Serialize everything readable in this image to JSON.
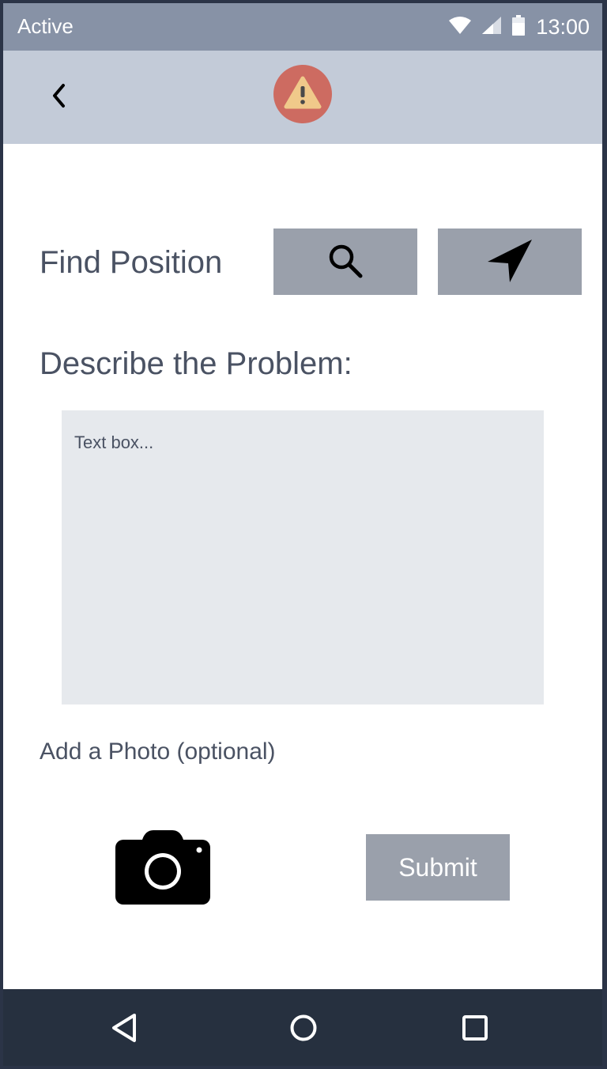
{
  "status_bar": {
    "carrier_text": "Active",
    "time": "13:00",
    "icons": [
      "wifi-icon",
      "signal-icon",
      "battery-icon"
    ]
  },
  "header": {
    "back_icon": "chevron-left-icon",
    "badge_icon": "warning-triangle-icon"
  },
  "form": {
    "find_position_label": "Find Position",
    "search_button_icon": "search-icon",
    "locate_button_icon": "navigation-arrow-icon",
    "describe_label": "Describe the Problem:",
    "textbox_placeholder": "Text box...",
    "textbox_value": "",
    "add_photo_label": "Add a Photo (optional)",
    "camera_icon": "camera-icon",
    "submit_label": "Submit"
  },
  "nav_bar": {
    "buttons": [
      "back-triangle-icon",
      "home-circle-icon",
      "recents-square-icon"
    ]
  },
  "colors": {
    "status_bar_bg": "#8792a6",
    "header_bg": "#c3cbd8",
    "badge_bg": "#cd6b61",
    "badge_triangle": "#f0c98a",
    "button_bg": "#9aa0ab",
    "textbox_bg": "#e6e9ed",
    "text": "#4a5263",
    "nav_bg": "#26303f"
  }
}
